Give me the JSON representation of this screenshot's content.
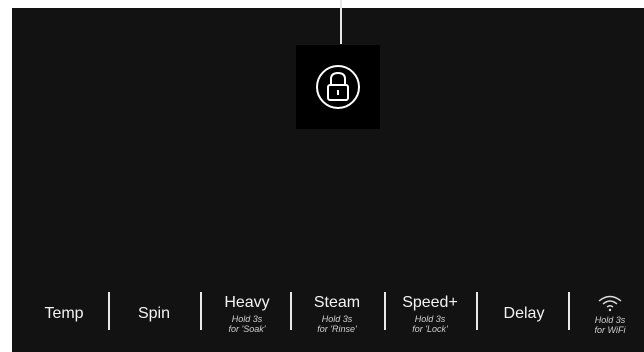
{
  "controls": {
    "temp": {
      "label": "Temp"
    },
    "spin": {
      "label": "Spin"
    },
    "heavy": {
      "label": "Heavy",
      "hint_line1": "Hold 3s",
      "hint_line2": "for 'Soak'"
    },
    "steam": {
      "label": "Steam",
      "hint_line1": "Hold 3s",
      "hint_line2": "for 'Rinse'"
    },
    "speed": {
      "label": "Speed+",
      "hint_line1": "Hold 3s",
      "hint_line2": "for 'Lock'"
    },
    "delay": {
      "label": "Delay"
    },
    "wifi": {
      "icon": "wifi-icon",
      "hint_line1": "Hold 3s",
      "hint_line2": "for WiFi"
    }
  },
  "lock": {
    "icon": "lock-icon"
  },
  "colors": {
    "background": "#121212",
    "lock_box": "#000000",
    "text": "#f3f3f3"
  }
}
